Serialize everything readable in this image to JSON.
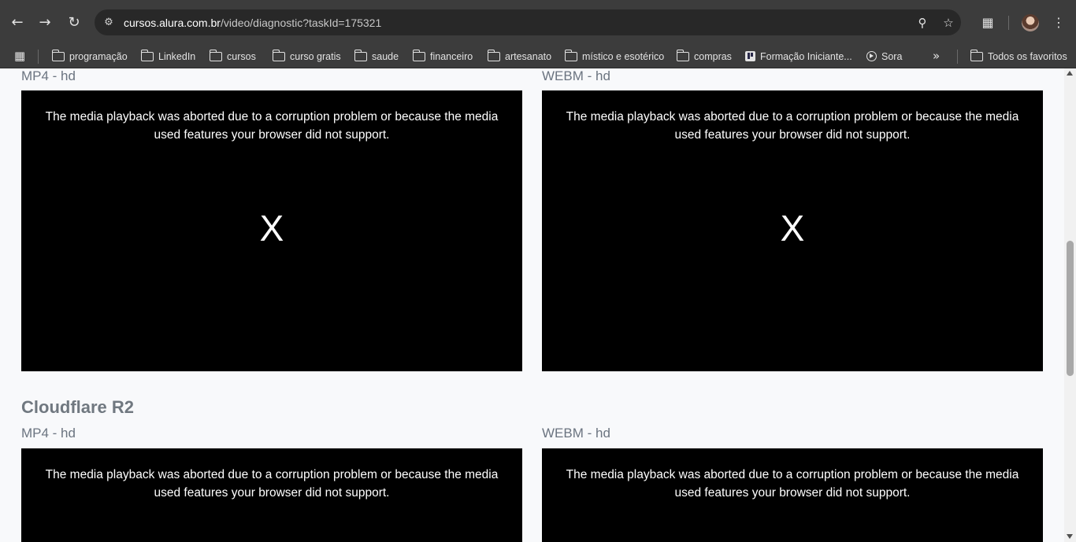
{
  "browser": {
    "url_host": "cursos.alura.com.br",
    "url_path": "/video/diagnostic?taskId=175321",
    "icons": [
      "back-arrow-icon",
      "forward-arrow-icon",
      "reload-icon",
      "site-info-icon",
      "zoom-icon",
      "bookmark-star-icon",
      "extensions-icon",
      "profile-avatar",
      "menu-kebab-icon"
    ]
  },
  "bookmarks": [
    {
      "label": "programação",
      "icon": "folder"
    },
    {
      "label": "LinkedIn",
      "icon": "folder"
    },
    {
      "label": "cursos",
      "icon": "folder"
    },
    {
      "label": "curso gratis",
      "icon": "folder"
    },
    {
      "label": "saude",
      "icon": "folder"
    },
    {
      "label": "financeiro",
      "icon": "folder"
    },
    {
      "label": "artesanato",
      "icon": "folder"
    },
    {
      "label": "místico e esotérico",
      "icon": "folder"
    },
    {
      "label": "compras",
      "icon": "folder"
    },
    {
      "label": "Formação Iniciante...",
      "icon": "trello"
    },
    {
      "label": "Sora",
      "icon": "sora"
    }
  ],
  "all_bookmarks_label": "Todos os favoritos",
  "page": {
    "top_section": {
      "left_label": "MP4 - hd",
      "right_label": "WEBM - hd"
    },
    "cloudflare_section": {
      "title": "Cloudflare R2",
      "left_label": "MP4 - hd",
      "right_label": "WEBM - hd"
    },
    "error_message": "The media playback was aborted due to a corruption problem or because the media used features your browser did not support.",
    "error_mark": "X"
  }
}
